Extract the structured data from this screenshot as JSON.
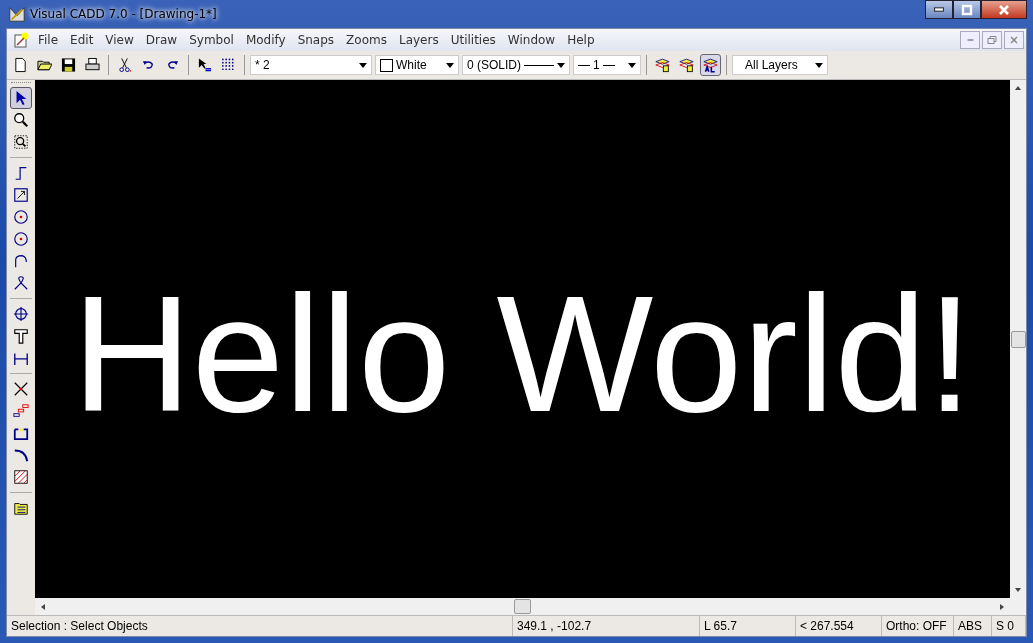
{
  "window": {
    "title": "Visual CADD 7.0 - [Drawing-1*]"
  },
  "menu": [
    "File",
    "Edit",
    "View",
    "Draw",
    "Symbol",
    "Modify",
    "Snaps",
    "Zooms",
    "Layers",
    "Utilities",
    "Window",
    "Help"
  ],
  "toolbar": {
    "line_width_combo": "* 2",
    "color_combo": "White",
    "line_type_combo": "0 (SOLID)",
    "scale_combo": "1",
    "layer_buttons": [
      {
        "selected": false
      },
      {
        "selected": false
      },
      {
        "selected": true
      }
    ],
    "layer_combo": "All Layers"
  },
  "tools": [
    [
      {
        "selected": true
      },
      {
        "selected": false
      },
      {
        "selected": false
      }
    ],
    [
      {
        "selected": false
      },
      {
        "selected": false
      },
      {
        "selected": false
      },
      {
        "selected": false
      },
      {
        "selected": false
      },
      {
        "selected": false
      }
    ],
    [
      {
        "selected": false
      },
      {
        "selected": false
      },
      {
        "selected": false
      }
    ],
    [
      {
        "selected": false
      },
      {
        "selected": false
      },
      {
        "selected": false
      },
      {
        "selected": false
      },
      {
        "selected": false
      }
    ],
    [
      {
        "selected": false
      }
    ]
  ],
  "canvas": {
    "text": "Hello World!"
  },
  "status_bar": [
    "Selection : Select Objects",
    "349.1  ,  -102.7",
    "L 65.7",
    "< 267.554",
    "Ortho: OFF",
    "ABS",
    "S 0"
  ]
}
